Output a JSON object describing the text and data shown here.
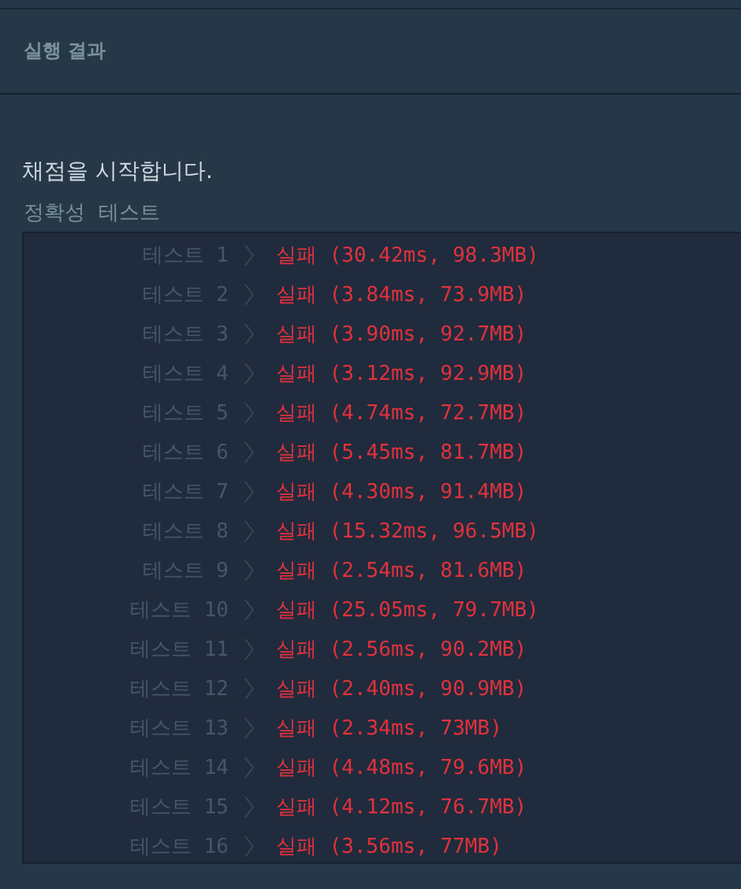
{
  "panel": {
    "title": "실행 결과"
  },
  "message": "채점을 시작합니다.",
  "section_label": "정확성  테스트",
  "results": [
    {
      "label": "테스트 1",
      "kind": "fail",
      "status": "실패",
      "detail": "(30.42ms, 98.3MB)"
    },
    {
      "label": "테스트 2",
      "kind": "fail",
      "status": "실패",
      "detail": "(3.84ms, 73.9MB)"
    },
    {
      "label": "테스트 3",
      "kind": "fail",
      "status": "실패",
      "detail": "(3.90ms, 92.7MB)"
    },
    {
      "label": "테스트 4",
      "kind": "fail",
      "status": "실패",
      "detail": "(3.12ms, 92.9MB)"
    },
    {
      "label": "테스트 5",
      "kind": "fail",
      "status": "실패",
      "detail": "(4.74ms, 72.7MB)"
    },
    {
      "label": "테스트 6",
      "kind": "fail",
      "status": "실패",
      "detail": "(5.45ms, 81.7MB)"
    },
    {
      "label": "테스트 7",
      "kind": "fail",
      "status": "실패",
      "detail": "(4.30ms, 91.4MB)"
    },
    {
      "label": "테스트 8",
      "kind": "fail",
      "status": "실패",
      "detail": "(15.32ms, 96.5MB)"
    },
    {
      "label": "테스트 9",
      "kind": "fail",
      "status": "실패",
      "detail": "(2.54ms, 81.6MB)"
    },
    {
      "label": "테스트 10",
      "kind": "fail",
      "status": "실패",
      "detail": "(25.05ms, 79.7MB)"
    },
    {
      "label": "테스트 11",
      "kind": "fail",
      "status": "실패",
      "detail": "(2.56ms, 90.2MB)"
    },
    {
      "label": "테스트 12",
      "kind": "fail",
      "status": "실패",
      "detail": "(2.40ms, 90.9MB)"
    },
    {
      "label": "테스트 13",
      "kind": "fail",
      "status": "실패",
      "detail": "(2.34ms, 73MB)"
    },
    {
      "label": "테스트 14",
      "kind": "fail",
      "status": "실패",
      "detail": "(4.48ms, 79.6MB)"
    },
    {
      "label": "테스트 15",
      "kind": "fail",
      "status": "실패",
      "detail": "(4.12ms, 76.7MB)"
    },
    {
      "label": "테스트 16",
      "kind": "fail",
      "status": "실패",
      "detail": "(3.56ms, 77MB)"
    }
  ]
}
